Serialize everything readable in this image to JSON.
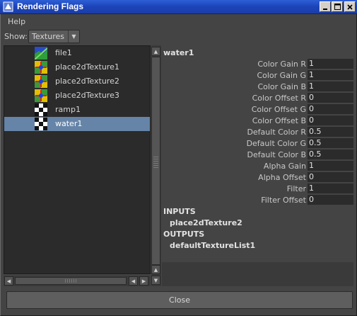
{
  "window": {
    "title": "Rendering Flags"
  },
  "menubar": {
    "items": [
      "Help"
    ]
  },
  "show": {
    "label": "Show:",
    "value": "Textures"
  },
  "list": {
    "items": [
      {
        "label": "file1",
        "icon": "file-texture-icon",
        "selected": false
      },
      {
        "label": "place2dTexture1",
        "icon": "place2d-texture-icon",
        "selected": false
      },
      {
        "label": "place2dTexture2",
        "icon": "place2d-texture-icon",
        "selected": false
      },
      {
        "label": "place2dTexture3",
        "icon": "place2d-texture-icon",
        "selected": false
      },
      {
        "label": "ramp1",
        "icon": "checker-texture-icon",
        "selected": false
      },
      {
        "label": "water1",
        "icon": "checker-texture-icon",
        "selected": true
      }
    ]
  },
  "attributes": {
    "node_name": "water1",
    "rows": [
      {
        "name": "Color Gain R",
        "value": "1"
      },
      {
        "name": "Color Gain G",
        "value": "1"
      },
      {
        "name": "Color Gain B",
        "value": "1"
      },
      {
        "name": "Color Offset R",
        "value": "0"
      },
      {
        "name": "Color Offset G",
        "value": "0"
      },
      {
        "name": "Color Offset B",
        "value": "0"
      },
      {
        "name": "Default Color R",
        "value": "0.5"
      },
      {
        "name": "Default Color G",
        "value": "0.5"
      },
      {
        "name": "Default Color B",
        "value": "0.5"
      },
      {
        "name": "Alpha Gain",
        "value": "1"
      },
      {
        "name": "Alpha Offset",
        "value": "0"
      },
      {
        "name": "Filter",
        "value": "1"
      },
      {
        "name": "Filter Offset",
        "value": "0"
      }
    ],
    "inputs_label": "INPUTS",
    "inputs": [
      "place2dTexture2"
    ],
    "outputs_label": "OUTPUTS",
    "outputs": [
      "defaultTextureList1"
    ]
  },
  "footer": {
    "close_label": "Close"
  },
  "colors": {
    "title_bar": "#1c43b8",
    "selection": "#6584a8",
    "panel_bg": "#444444",
    "list_bg": "#2b2b2b"
  }
}
